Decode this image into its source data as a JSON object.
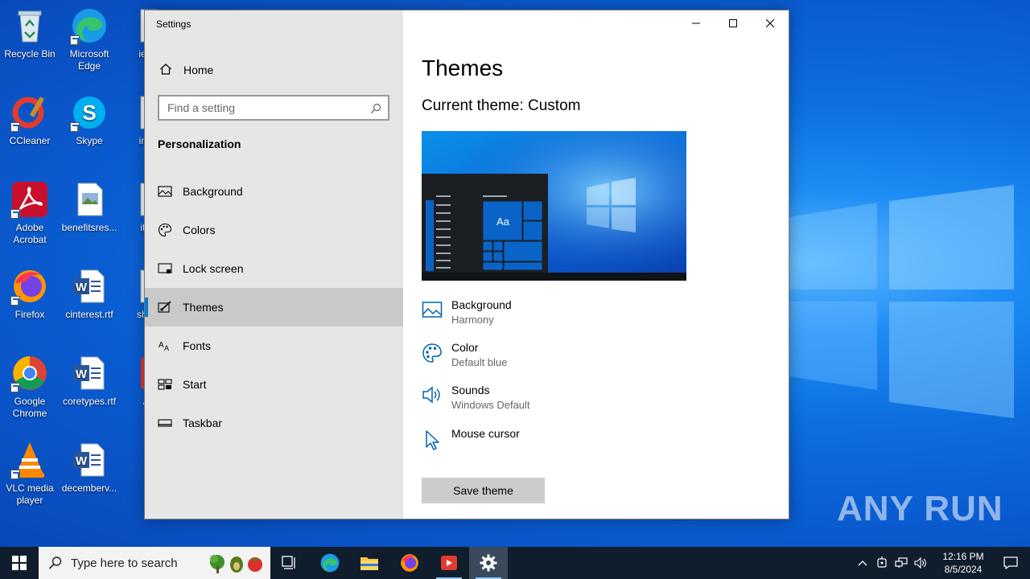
{
  "desktop": {
    "icons": [
      {
        "label": "Recycle Bin"
      },
      {
        "label": "Microsoft Edge"
      },
      {
        "label": "ieind"
      },
      {
        "label": "CCleaner"
      },
      {
        "label": "Skype"
      },
      {
        "label": "inclu"
      },
      {
        "label": "Adobe Acrobat"
      },
      {
        "label": "benefitsres..."
      },
      {
        "label": "itsja"
      },
      {
        "label": "Firefox"
      },
      {
        "label": "cinterest.rtf"
      },
      {
        "label": "share"
      },
      {
        "label": "Google Chrome"
      },
      {
        "label": "coretypes.rtf"
      },
      {
        "label": "An"
      },
      {
        "label": "VLC media player"
      },
      {
        "label": "decemberv..."
      }
    ],
    "watermark": "ANY RUN"
  },
  "window": {
    "title": "Settings",
    "home_label": "Home",
    "search_placeholder": "Find a setting",
    "section_heading": "Personalization",
    "nav_items": [
      {
        "label": "Background",
        "icon": "picture-icon"
      },
      {
        "label": "Colors",
        "icon": "palette-icon"
      },
      {
        "label": "Lock screen",
        "icon": "lock-screen-icon"
      },
      {
        "label": "Themes",
        "icon": "brush-icon",
        "selected": true
      },
      {
        "label": "Fonts",
        "icon": "font-icon"
      },
      {
        "label": "Start",
        "icon": "start-tiles-icon"
      },
      {
        "label": "Taskbar",
        "icon": "taskbar-icon"
      }
    ]
  },
  "content": {
    "title": "Themes",
    "current_theme": "Current theme: Custom",
    "preview_tile_text": "Aa",
    "properties": [
      {
        "title": "Background",
        "value": "Harmony",
        "icon": "picture-icon"
      },
      {
        "title": "Color",
        "value": "Default blue",
        "icon": "palette-icon"
      },
      {
        "title": "Sounds",
        "value": "Windows Default",
        "icon": "speaker-icon"
      },
      {
        "title": "Mouse cursor",
        "value": "",
        "icon": "cursor-icon"
      }
    ],
    "save_button": "Save theme"
  },
  "taskbar": {
    "search_placeholder": "Type here to search",
    "time": "12:16 PM",
    "date": "8/5/2024",
    "apps": [
      "task-view",
      "edge",
      "file-explorer",
      "firefox",
      "anyrun",
      "settings"
    ]
  },
  "colors": {
    "accent": "#0078d4",
    "nav_background": "#e6e6e6",
    "taskbar": "#101d2c"
  }
}
